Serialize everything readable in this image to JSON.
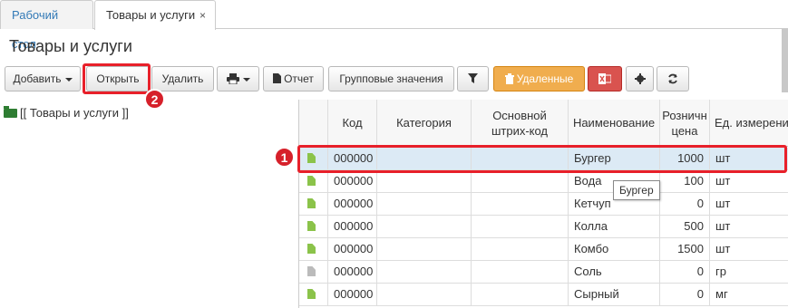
{
  "tabs": [
    {
      "label": "Рабочий стол"
    },
    {
      "label": "Товары и услуги",
      "close": "×"
    }
  ],
  "page_title": "Товары и услуги",
  "toolbar": {
    "add": "Добавить",
    "open": "Открыть",
    "delete": "Удалить",
    "report": "Отчет",
    "group_values": "Групповые значения",
    "deleted": "Удаленные"
  },
  "tree": {
    "root_label": "[[ Товары и услуги ]]"
  },
  "columns": {
    "code": "Код",
    "category": "Категория",
    "barcode_1": "Основной",
    "barcode_2": "штрих-код",
    "name": "Наименование",
    "price_1": "Розничн",
    "price_2": "цена",
    "unit": "Ед. измерени"
  },
  "rows": [
    {
      "code": "000000",
      "category": "",
      "barcode": "",
      "name": "Бургер",
      "price": "1000",
      "unit": "шт",
      "icon": "document-icon",
      "selected": true
    },
    {
      "code": "000000",
      "category": "",
      "barcode": "",
      "name": "Вода",
      "price": "100",
      "unit": "шт",
      "icon": "document-icon"
    },
    {
      "code": "000000",
      "category": "",
      "barcode": "",
      "name": "Кетчуп",
      "price": "0",
      "unit": "шт",
      "icon": "document-icon"
    },
    {
      "code": "000000",
      "category": "",
      "barcode": "",
      "name": "Колла",
      "price": "500",
      "unit": "шт",
      "icon": "document-icon"
    },
    {
      "code": "000000",
      "category": "",
      "barcode": "",
      "name": "Комбо",
      "price": "1500",
      "unit": "шт",
      "icon": "document-icon"
    },
    {
      "code": "000000",
      "category": "",
      "barcode": "",
      "name": "Соль",
      "price": "0",
      "unit": "гр",
      "icon": "document-icon"
    },
    {
      "code": "000000",
      "category": "",
      "barcode": "",
      "name": "Сырный",
      "price": "0",
      "unit": "мг",
      "icon": "document-icon"
    }
  ],
  "tooltip": "Бургер",
  "callouts": {
    "first": "1",
    "second": "2"
  },
  "colors": {
    "highlight": "#e8202a",
    "selected_row": "#dceaf5",
    "deleted_button": "#f0ad4e",
    "excel_button": "#d9534f",
    "doc_icon": "#8bc34a"
  }
}
